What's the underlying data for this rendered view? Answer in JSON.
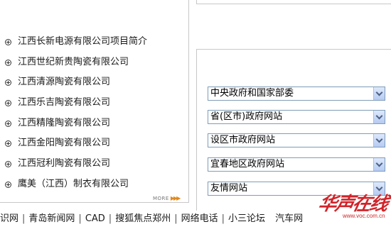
{
  "company_list": {
    "items": [
      {
        "label": "江西长新电源有限公司项目简介"
      },
      {
        "label": "江西世纪新贵陶瓷有限公司"
      },
      {
        "label": "江西清源陶瓷有限公司"
      },
      {
        "label": "江西乐吉陶瓷有限公司"
      },
      {
        "label": "江西精隆陶瓷有限公司"
      },
      {
        "label": "江西金阳陶瓷有限公司"
      },
      {
        "label": "江西冠利陶瓷有限公司"
      },
      {
        "label": "鹰美（江西）制衣有限公司"
      }
    ],
    "more_label": "MORE"
  },
  "gov_links": {
    "selects": [
      {
        "selected": "中央政府和国家部委"
      },
      {
        "selected": "省(区市)政府网站"
      },
      {
        "selected": "设区市政府网站"
      },
      {
        "selected": "宜春地区政府网站"
      },
      {
        "selected": "友情网站"
      }
    ]
  },
  "footer": {
    "links": [
      "识网",
      "青岛新闻网",
      "CAD",
      "搜狐焦点郑州",
      "网络电话",
      "小三论坛",
      "汽车网"
    ]
  },
  "watermark": {
    "logo_text": "华声在线",
    "url": "www.voc.com.cn"
  },
  "colors": {
    "watermark": "#d0242a",
    "select_border": "#7f9db9",
    "more_arrows": "#e08a1e"
  }
}
